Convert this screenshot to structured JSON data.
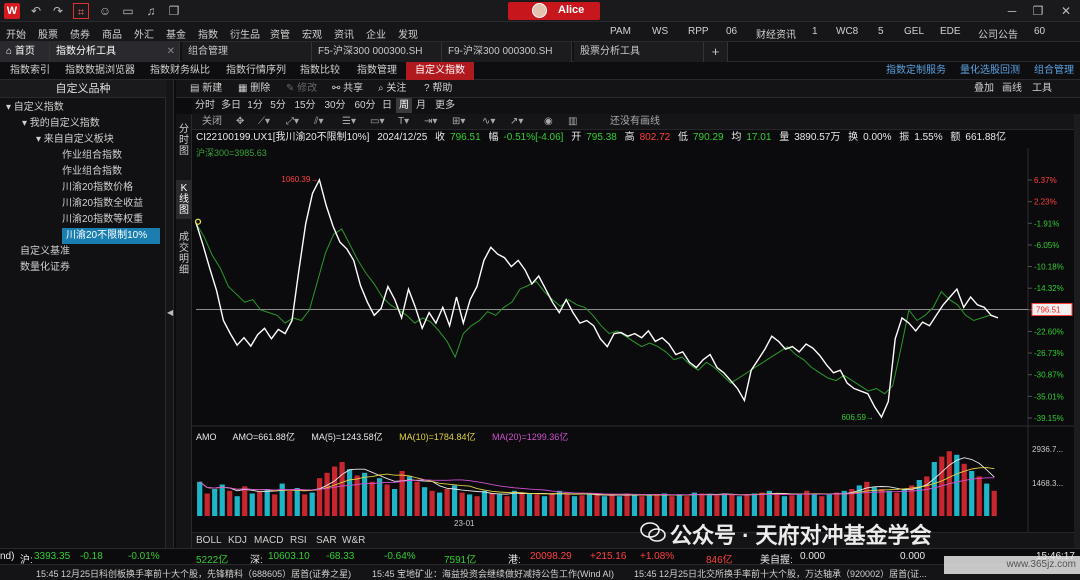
{
  "titlebar": {
    "logo": "W",
    "username": "Alice",
    "icons": [
      "back-icon",
      "forward-icon",
      "crop-icon",
      "chat-icon",
      "tv-icon",
      "bell-icon",
      "window-icon"
    ]
  },
  "menu": {
    "items": [
      "开始",
      "股票",
      "债券",
      "商品",
      "外汇",
      "基金",
      "指数",
      "衍生品",
      "资管",
      "宏观",
      "资讯",
      "企业",
      "发现"
    ],
    "right": [
      "PAM",
      "WS",
      "RPP",
      "06",
      "财经资讯",
      "1",
      "WC8",
      "5",
      "GEL",
      "EDE",
      "公司公告",
      "60"
    ]
  },
  "tabs": {
    "home": "首页",
    "items": [
      "指数分析工具",
      "组合管理",
      "F5-沪深300 000300.SH",
      "F9-沪深300 000300.SH",
      "股票分析工具"
    ],
    "add": "+"
  },
  "subnav": {
    "items": [
      "指数索引",
      "指数数据浏览器",
      "指数财务纵比",
      "指数行情序列",
      "指数比较",
      "指数管理",
      "自定义指数"
    ],
    "active": "自定义指数",
    "right": [
      "指数定制服务",
      "量化选股回测",
      "组合管理"
    ]
  },
  "leftpanel": {
    "title": "自定义品种",
    "tree": [
      {
        "label": "▾ 自定义指数",
        "indent": 0
      },
      {
        "label": "▾ 我的自定义指数",
        "indent": 1
      },
      {
        "label": "▾ 来自自定义板块",
        "indent": 2
      },
      {
        "label": "作业组合指数",
        "indent": 3
      },
      {
        "label": "作业组合指数",
        "indent": 3
      },
      {
        "label": "川渝20指数价格",
        "indent": 3
      },
      {
        "label": "川渝20指数全收益",
        "indent": 3
      },
      {
        "label": "川渝20指数等权重",
        "indent": 3
      },
      {
        "label": "川渝20不限制10%",
        "indent": 3,
        "selected": true
      },
      {
        "label": "自定义基准",
        "indent": 0
      },
      {
        "label": "数量化证券",
        "indent": 0
      }
    ]
  },
  "toolbar": {
    "new": "新建",
    "delete": "删除",
    "modify": "修改",
    "share": "共享",
    "follow": "关注",
    "help": "帮助",
    "right": [
      "叠加",
      "画线",
      "工具"
    ]
  },
  "periods": {
    "items": [
      "分时",
      "多日",
      "1分",
      "5分",
      "15分",
      "30分",
      "60分",
      "日",
      "周",
      "月",
      "更多"
    ],
    "active": "周"
  },
  "vtabs": [
    "分时图",
    "K线图",
    "成交明细"
  ],
  "chart_toolbar": {
    "close": "关闭",
    "restore": "还没有画线"
  },
  "info": {
    "code": "CI22100199.UX1[我川渝20不限制10%]",
    "date": "2024/12/25",
    "close_label": "收",
    "close": "796.51",
    "chg_label": "幅",
    "chg": "-0.51%[-4.06]",
    "open_label": "开",
    "open": "795.38",
    "high_label": "高",
    "high": "802.72",
    "low_label": "低",
    "low": "790.29",
    "avg_label": "均",
    "avg": "17.01",
    "vol_label": "量",
    "vol": "3890.57万",
    "turn_label": "换",
    "turn": "0.00%",
    "amp_label": "振",
    "amp": "1.55%",
    "amt_label": "额",
    "amt": "661.88亿"
  },
  "hs300": "沪深300=3985.63",
  "annotations": {
    "high": "1060.39",
    "low": "606.59",
    "last_tag": "796.51"
  },
  "y_axis": [
    "6.37%",
    "2.23%",
    "-1.91%",
    "-6.05%",
    "-10.18%",
    "-14.32%",
    "-18.46%",
    "-22.60%",
    "-26.73%",
    "-30.87%",
    "-35.01%",
    "-39.15%"
  ],
  "volume": {
    "label": "AMO",
    "amo": "AMO=661.88亿",
    "ma5": "MA(5)=1243.58亿",
    "ma10": "MA(10)=1784.84亿",
    "ma20": "MA(20)=1299.36亿",
    "y_axis": [
      "2936.7...",
      "1468.3..."
    ],
    "x_label": "23-01"
  },
  "bottom_tabs": [
    "BOLL",
    "KDJ",
    "MACD",
    "RSI",
    "SAR",
    "W&R"
  ],
  "status": {
    "sh_label": "沪:",
    "sh": "3393.35",
    "sh_chg": "-0.18",
    "sh_pct": "-0.01%",
    "sh_amt": "5222亿",
    "sz_label": "深:",
    "sz": "10603.10",
    "sz_chg": "-68.33",
    "sz_pct": "-0.64%",
    "sz_amt": "7591亿",
    "hk_label": "港:",
    "hk": "20098.29",
    "hk_chg": "+215.16",
    "hk_pct": "+1.08%",
    "hk_amt": "846亿",
    "us_label": "美自握:",
    "us": "0.000",
    "us2": "0.000",
    "lead": "nd)",
    "clock": "15:46:17"
  },
  "news": [
    "15:45  12月25日科创板换手率前十大个股，先锋精科（688605）居首(证券之星)",
    "15:45  宝地矿业：海益投资会继续做好减持公告工作(Wind AI)",
    "15:45  12月25日北交所换手率前十大个股，万达轴承（920002）居首(证..."
  ],
  "watermark": "公众号 · 天府对冲基金学会",
  "site": "www.365jz.com",
  "chart_data": {
    "type": "line",
    "y_unit": "%",
    "ylim": [
      -39.15,
      6.37
    ],
    "y_ticks": [
      6.37,
      2.23,
      -1.91,
      -6.05,
      -10.18,
      -14.32,
      -18.46,
      -22.6,
      -26.73,
      -30.87,
      -35.01,
      -39.15
    ],
    "series": [
      {
        "name": "CI22100199.UX1",
        "color": "#ffffff",
        "values": [
          -1.8,
          -6.0,
          -10.5,
          -14.8,
          -20.5,
          -23.0,
          -25.2,
          -23.8,
          -25.4,
          -23.2,
          -22.0,
          -24.0,
          -22.2,
          -23.0,
          -20.5,
          -11.0,
          -2.0,
          3.8,
          6.4,
          1.5,
          -2.5,
          -5.5,
          -6.8,
          -9.0,
          -13.8,
          -17.0,
          -19.5,
          -18.2,
          -14.0,
          -16.5,
          -20.0,
          -14.5,
          -18.0,
          -22.0,
          -19.0,
          -21.0,
          -18.0,
          -21.5,
          -16.0,
          -21.0,
          -16.5,
          -14.0,
          -9.0,
          -6.5,
          -7.8,
          -8.5,
          -10.2,
          -9.0,
          -10.8,
          -13.5,
          -12.0,
          -14.5,
          -17.0,
          -19.0,
          -16.5,
          -19.0,
          -21.0,
          -20.5,
          -21.5,
          -24.0,
          -25.5,
          -23.0,
          -22.8,
          -23.5,
          -23.0,
          -23.8,
          -22.5,
          -24.5,
          -23.8,
          -25.0,
          -27.0,
          -26.5,
          -28.5,
          -29.5,
          -28.0,
          -27.0,
          -29.5,
          -30.5,
          -32.0,
          -33.5,
          -35.8,
          -30.0,
          -28.0,
          -26.0,
          -23.5,
          -24.5,
          -26.0,
          -25.5,
          -26.5,
          -25.0,
          -25.8,
          -27.2,
          -29.0,
          -30.5,
          -30.0,
          -32.5,
          -33.5,
          -34.0,
          -34.5,
          -37.0,
          -39.0,
          -36.0,
          -24.0,
          -20.0,
          -21.0,
          -22.5,
          -20.8,
          -21.5,
          -19.5,
          -17.5,
          -16.0,
          -14.5,
          -18.0,
          -16.0,
          -17.5,
          -18.0,
          -19.5,
          -20.0
        ]
      },
      {
        "name": "沪深300",
        "color": "#2a9a2a",
        "values": [
          -1.9,
          -4.5,
          -8.0,
          -10.5,
          -14.0,
          -15.5,
          -17.0,
          -16.5,
          -18.5,
          -19.0,
          -19.5,
          -21.0,
          -20.0,
          -20.5,
          -18.5,
          -13.0,
          -7.5,
          -4.0,
          -3.0,
          -6.0,
          -9.0,
          -11.5,
          -13.5,
          -16.0,
          -17.5,
          -18.5,
          -19.5,
          -21.0,
          -20.0,
          -20.8,
          -22.5,
          -24.5,
          -27.5,
          -23.0,
          -21.5,
          -20.5,
          -18.8,
          -19.5,
          -18.0,
          -17.0,
          -14.5,
          -13.8,
          -13.0,
          -15.0,
          -16.5,
          -17.8,
          -16.5,
          -17.5,
          -18.0,
          -19.5,
          -21.5,
          -23.0,
          -22.5,
          -23.5,
          -24.5,
          -25.5,
          -24.8,
          -25.5,
          -26.5,
          -28.0,
          -27.5,
          -29.0,
          -30.0,
          -28.5,
          -29.5,
          -31.0,
          -32.5,
          -31.5,
          -30.5,
          -29.5,
          -28.5,
          -27.5,
          -26.5,
          -25.5,
          -27.0,
          -28.0,
          -29.5,
          -30.5,
          -31.5,
          -32.0,
          -31.0,
          -32.0,
          -33.0,
          -34.0,
          -33.5,
          -34.5,
          -33.0,
          -26.0,
          -18.5,
          -20.5,
          -19.5,
          -18.0,
          -15.0,
          -16.5,
          -17.5,
          -19.5,
          -20.5,
          -20.0,
          -19.5,
          -20.0
        ]
      }
    ],
    "volume": {
      "bars": [
        38,
        25,
        30,
        35,
        28,
        22,
        33,
        25,
        27,
        30,
        24,
        36,
        28,
        31,
        24,
        26,
        42,
        48,
        55,
        60,
        52,
        45,
        48,
        38,
        42,
        35,
        30,
        50,
        44,
        38,
        32,
        28,
        26,
        30,
        34,
        26,
        24,
        22,
        28,
        25,
        24,
        22,
        28,
        26,
        25,
        24,
        22,
        25,
        28,
        24,
        22,
        23,
        25,
        24,
        22,
        23,
        22,
        25,
        24,
        22,
        23,
        24,
        25,
        22,
        24,
        22,
        26,
        25,
        24,
        23,
        25,
        24,
        22,
        23,
        25,
        26,
        28,
        24,
        22,
        23,
        25,
        28,
        24,
        22,
        24,
        26,
        28,
        30,
        34,
        38,
        32,
        30,
        28,
        26,
        30,
        34,
        40,
        44,
        60,
        66,
        72,
        68,
        58,
        50,
        44,
        36,
        28
      ],
      "colors": [
        "c",
        "r",
        "c",
        "c",
        "r",
        "c",
        "r",
        "c",
        "r",
        "c",
        "r",
        "c",
        "r",
        "c",
        "r",
        "c",
        "r",
        "r",
        "r",
        "r",
        "c",
        "r",
        "c",
        "r",
        "c",
        "r",
        "c",
        "r",
        "c",
        "r",
        "c",
        "r",
        "c",
        "r",
        "c",
        "r",
        "c",
        "r",
        "c",
        "r",
        "c",
        "r",
        "c",
        "r",
        "c",
        "r",
        "c",
        "r",
        "c",
        "r",
        "c",
        "r",
        "c",
        "r",
        "c",
        "r",
        "c",
        "r",
        "c",
        "r",
        "c",
        "r",
        "c",
        "r",
        "c",
        "r",
        "c",
        "r",
        "c",
        "r",
        "c",
        "r",
        "c",
        "r",
        "c",
        "r",
        "c",
        "r",
        "c",
        "r",
        "c",
        "r",
        "c",
        "r",
        "c",
        "r",
        "c",
        "r",
        "c",
        "r",
        "c",
        "r",
        "c",
        "r",
        "c",
        "r",
        "c",
        "r",
        "c",
        "r",
        "r",
        "c",
        "r",
        "c",
        "r",
        "c",
        "r"
      ]
    }
  }
}
